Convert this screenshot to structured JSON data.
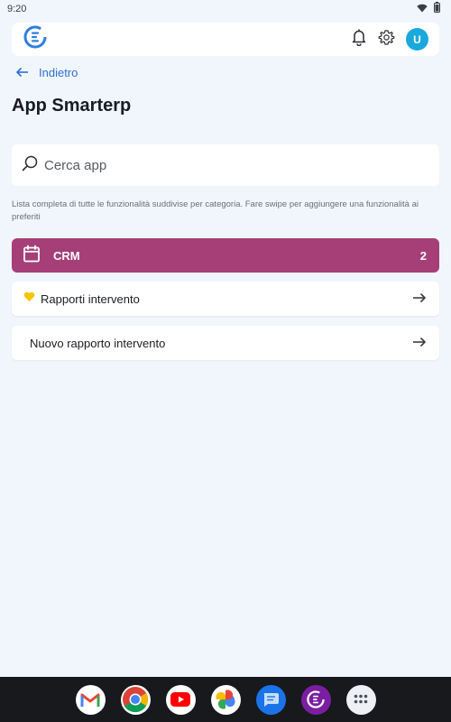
{
  "status_bar": {
    "time": "9:20"
  },
  "header": {
    "avatar_initial": "U"
  },
  "back": {
    "label": "Indietro"
  },
  "page": {
    "title": "App Smarterp"
  },
  "search": {
    "placeholder": "Cerca app"
  },
  "help_text": "Lista completa di tutte le funzionalità suddivise per categoria. Fare swipe per aggiungere una funzionalità ai preferiti",
  "category": {
    "name": "CRM",
    "count": "2",
    "color": "#a63f78"
  },
  "items": [
    {
      "label": "Rapporti intervento",
      "favorite": true
    },
    {
      "label": "Nuovo rapporto intervento",
      "favorite": false
    }
  ],
  "dock": {
    "apps": [
      "gmail-icon",
      "chrome-icon",
      "youtube-icon",
      "photos-icon",
      "messages-icon",
      "smarterp-icon",
      "app-drawer-icon"
    ]
  },
  "colors": {
    "accent": "#2e6fd6",
    "avatar": "#1aa9dc",
    "background": "#f1f6fc",
    "favorite": "#f7c600"
  }
}
